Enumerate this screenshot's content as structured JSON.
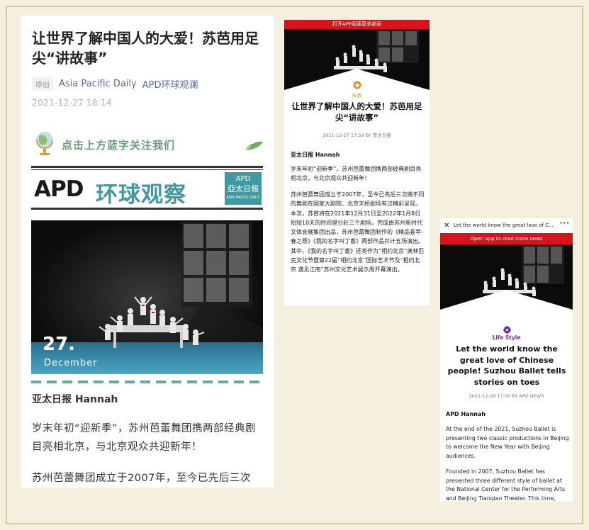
{
  "wechat_article": {
    "title": "让世界了解中国人的大爱！苏芭用足尖“讲故事”",
    "original_tag": "原创",
    "source": "Asia Pacific Daily",
    "account": "APD环球观澜",
    "date": "2021-12-27 18:14",
    "follow_text": "点击上方蓝字关注我们",
    "banner_apd": "APD",
    "banner_cn": "环球观察",
    "banner_logo_line1": "APD",
    "banner_logo_line2": "亞太日報",
    "banner_logo_line3": "ASIA PACIFIC DAILY",
    "photo_day": "27.",
    "photo_month": "December",
    "author": "亚太日报 Hannah",
    "para1": "岁末年初“迎新季”，苏州芭蕾舞团携两部经典剧目亮相北京，与北京观众共迎新年！",
    "para2": "苏州芭蕾舞团成立于2007年，至今已先后三次"
  },
  "cn_mobile": {
    "top_bar": "打开APP阅读更多新闻",
    "channel": "头条",
    "title": "让世界了解中国人的大爱！苏芭用足尖“讲故事”",
    "pub_meta": "2021-12-27 17:59 BY 亚太日报",
    "author": "亚太日报 Hannah",
    "para1": "岁末年初“迎新季”，苏州芭蕾舞团携两部经典剧目亮相北京，与北京观众共迎新年！",
    "para2": "苏州芭蕾舞团成立于2007年，至今已先后三次携不同的舞剧在国家大剧院、北京天桥剧场有过精彩呈现。本次，苏芭将在2021年12月31日至2022年1月8日短短10天的时间里分赴三个剧场，完成由苏州新时代文体会展集团出品，苏州芭蕾舞团制作的《精品荟萃-春之祭》《我的名字叫丁香》两部作品共计五场演出。其中，《我的名字叫丁香》还将作为“相约北京”奥林匹克文化节暨第22届“相约北京”国际艺术节及“相约北京 遇见江南”苏州文化艺术展示周开幕演出。"
  },
  "en_mobile": {
    "nav_title": "Let the world know the great love of C...",
    "close_icon": "close-icon",
    "more_icon": "more-icon",
    "top_bar": "Open app to read more news",
    "channel": "Life Style",
    "title": "Let the world know the great love of Chinese people! Suzhou Ballet tells stories on toes",
    "pub_meta": "2021-12-28 17:00 BY APD NEWS",
    "author": "APD Hannah",
    "para1": "At the end of the 2021, Suzhou Ballet is presenting two classic productions in Beijing to welcome the New Year with Beijing audiences.",
    "para2": "Founded in 2007, Suzhou Ballet has presented three different style of ballet at the National Center for the Performing Arts and Beijing Tianqiao Theater. This time,"
  },
  "colors": {
    "frame_border": "#d8c79a",
    "background": "#f5efe0",
    "red_bar": "#d9131b",
    "banner_teal": "#3e9aa0",
    "channel_orange": "#e6861e",
    "channel_purple": "#7b2aa8"
  }
}
